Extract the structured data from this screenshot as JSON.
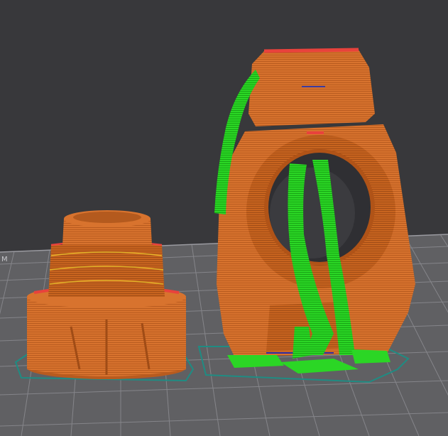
{
  "app": {
    "view": "slicer-preview-3d",
    "background_color": "#3a3a3d",
    "bed_color": "#5f5f62",
    "grid_line_color": "#8a8a8e"
  },
  "scene": {
    "objects": [
      {
        "name": "threaded-cap",
        "color": "#d8732e"
      },
      {
        "name": "bearing-housing-part",
        "color": "#d8732e"
      }
    ],
    "toolpath_colors": {
      "wall": "#d8732e",
      "perimeter_edge": "#e8423c",
      "infill_highlight": "#e5b42a",
      "support": "#23d01f",
      "skirt": "#1f8c83"
    },
    "bed_edge_text": "M"
  }
}
